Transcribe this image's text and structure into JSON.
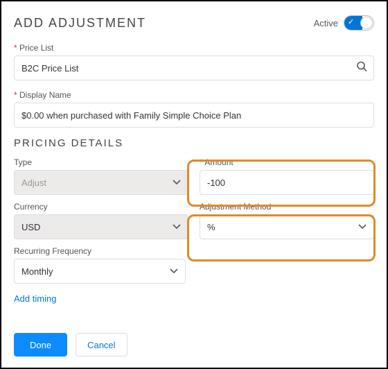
{
  "header": {
    "title": "ADD ADJUSTMENT",
    "active_label": "Active",
    "active_on": true
  },
  "price_list": {
    "label": "Price List",
    "value": "B2C Price List"
  },
  "display_name": {
    "label": "Display Name",
    "value": "$0.00 when purchased with Family Simple Choice Plan"
  },
  "section_title": "PRICING DETAILS",
  "type": {
    "label": "Type",
    "value": "Adjust"
  },
  "amount": {
    "label": "Amount",
    "value": "-100"
  },
  "currency": {
    "label": "Currency",
    "value": "USD"
  },
  "method": {
    "label": "Adjustment Method",
    "value": "%"
  },
  "recurring": {
    "label": "Recurring Frequency",
    "value": "Monthly"
  },
  "add_timing": "Add timing",
  "buttons": {
    "done": "Done",
    "cancel": "Cancel"
  }
}
